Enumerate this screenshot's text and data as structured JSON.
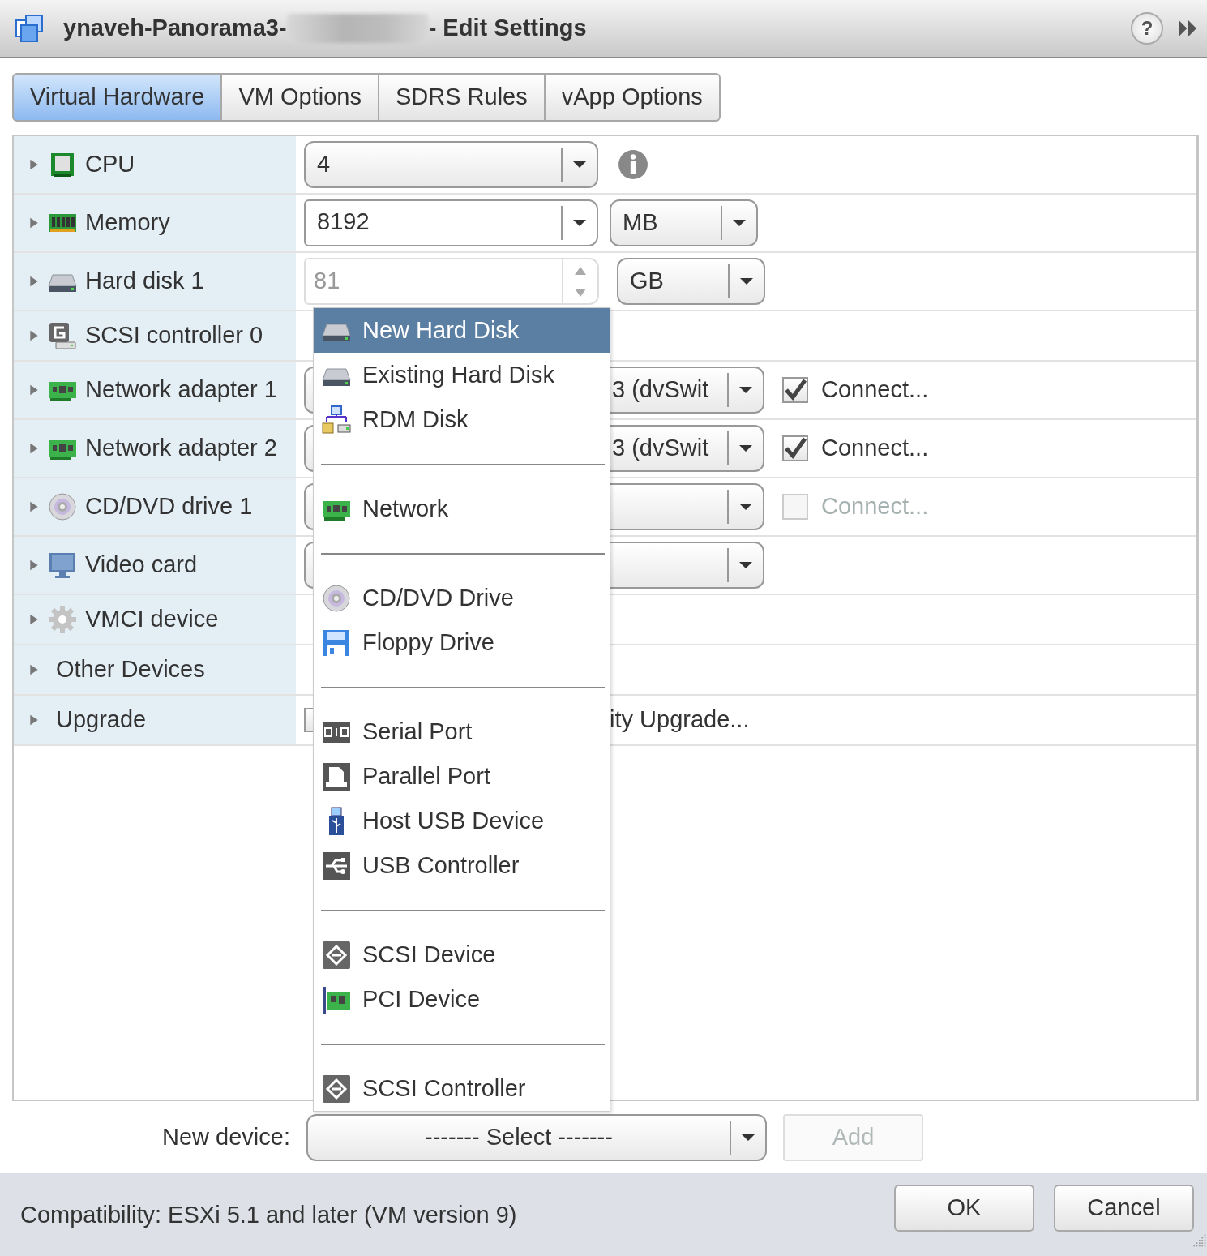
{
  "window": {
    "title_prefix": "ynaveh-Panorama3-",
    "title_suffix": "- Edit Settings",
    "help_label": "?"
  },
  "tabs": [
    {
      "label": "Virtual Hardware",
      "selected": true
    },
    {
      "label": "VM Options",
      "selected": false
    },
    {
      "label": "SDRS Rules",
      "selected": false
    },
    {
      "label": "vApp Options",
      "selected": false
    }
  ],
  "devices": [
    {
      "label": "CPU",
      "kind": "combo_info",
      "value": "4",
      "expanded": false
    },
    {
      "label": "Memory",
      "kind": "combo_unit",
      "value": "8192",
      "unit": "MB",
      "expanded": false
    },
    {
      "label": "Hard disk 1",
      "kind": "spinner_unit",
      "value": "81",
      "unit": "GB",
      "expanded": false
    },
    {
      "label": "SCSI controller 0",
      "kind": "none",
      "expanded": false
    },
    {
      "label": "Network adapter 1",
      "kind": "select_connect",
      "value": "3 (dvSwit",
      "connect_label": "Connect...",
      "checked": true,
      "disabled": false,
      "expanded": false
    },
    {
      "label": "Network adapter 2",
      "kind": "select_connect",
      "value": "3 (dvSwit",
      "connect_label": "Connect...",
      "checked": true,
      "disabled": false,
      "expanded": false
    },
    {
      "label": "CD/DVD drive 1",
      "kind": "select_connect",
      "connect_label": "Connect...",
      "checked": false,
      "disabled": true,
      "expanded": false
    },
    {
      "label": "Video card",
      "kind": "select",
      "expanded": false
    },
    {
      "label": "VMCI device",
      "kind": "none",
      "expanded": false
    },
    {
      "label": "Other Devices",
      "kind": "none",
      "expanded": false
    },
    {
      "label": "Upgrade",
      "kind": "upgrade",
      "value": "ity Upgrade...",
      "checked": false,
      "expanded": false
    }
  ],
  "menu": [
    {
      "kind": "hdd",
      "label": "New Hard Disk",
      "selected": true
    },
    {
      "kind": "hdd",
      "label": "Existing Hard Disk",
      "selected": false
    },
    {
      "kind": "rdm",
      "label": "RDM Disk",
      "selected": false
    },
    {
      "kind": "separator"
    },
    {
      "kind": "net",
      "label": "Network",
      "selected": false
    },
    {
      "kind": "separator"
    },
    {
      "kind": "disc",
      "label": "CD/DVD Drive",
      "selected": false
    },
    {
      "kind": "floppy",
      "label": "Floppy Drive",
      "selected": false
    },
    {
      "kind": "separator"
    },
    {
      "kind": "serial",
      "label": "Serial Port",
      "selected": false
    },
    {
      "kind": "parallel",
      "label": "Parallel Port",
      "selected": false
    },
    {
      "kind": "usb",
      "label": "Host USB Device",
      "selected": false
    },
    {
      "kind": "usbctl",
      "label": "USB Controller",
      "selected": false
    },
    {
      "kind": "separator"
    },
    {
      "kind": "scsi2",
      "label": "SCSI Device",
      "selected": false
    },
    {
      "kind": "pci",
      "label": "PCI Device",
      "selected": false
    },
    {
      "kind": "separator"
    },
    {
      "kind": "scsi2",
      "label": "SCSI Controller",
      "selected": false
    }
  ],
  "new_device": {
    "label": "New device:",
    "select": "------- Select -------",
    "add_button": {
      "label": "Add",
      "disabled": true
    }
  },
  "footer": {
    "compatibility": "Compatibility: ESXi 5.1 and later (VM version 9)",
    "buttons": [
      "OK",
      "Cancel"
    ]
  }
}
